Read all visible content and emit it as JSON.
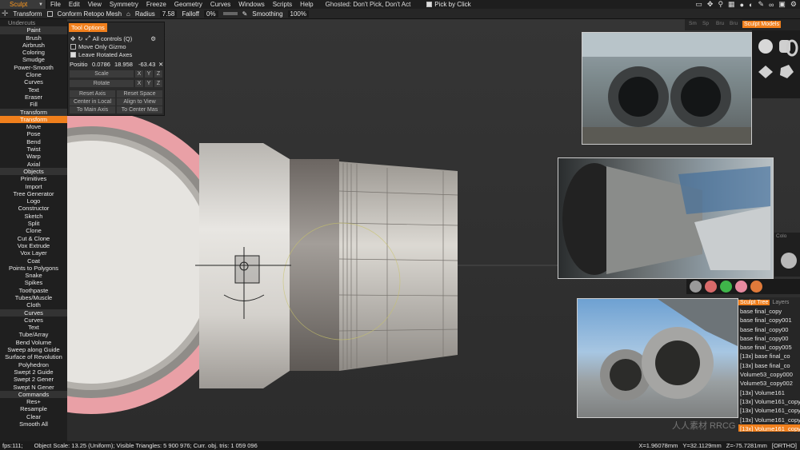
{
  "menubar": {
    "mode": "Sculpt",
    "items": [
      "File",
      "Edit",
      "View",
      "Symmetry",
      "Freeze",
      "Geometry",
      "Curves",
      "Windows",
      "Scripts",
      "Help"
    ],
    "ghosted": "Ghosted: Don't Pick, Don't Act",
    "pick_by_click": "Pick by Click"
  },
  "toolbar": {
    "tool": "Transform",
    "conform": "Conform Retopo Mesh",
    "radius_label": "Radius",
    "radius_value": "7.58",
    "falloff_label": "Falloff",
    "falloff_value": "0%",
    "smoothing_label": "Smoothing",
    "smoothing_value": "100%"
  },
  "left_panel": {
    "top_cut": "Undercuts",
    "paint_header": "Paint",
    "paint": [
      "Brush",
      "Airbrush",
      "Coloring",
      "Smudge",
      "Power-Smooth",
      "Clone",
      "Curves",
      "Text",
      "Eraser",
      "Fill"
    ],
    "transform_header": "Transform",
    "transform": [
      "Transform",
      "Move",
      "Pose",
      "Bend",
      "Twist",
      "Warp",
      "Axial"
    ],
    "objects_header": "Objects",
    "objects": [
      "Primitives",
      "Import",
      "Tree Generator",
      "Logo",
      "Constructor",
      "Sketch",
      "Split",
      "Clone",
      "Cut & Clone",
      "Vox Extrude",
      "Vox Layer",
      "Coat",
      "Points to Polygons",
      "Snake",
      "Spikes",
      "Toothpaste",
      "Tubes/Muscle",
      "Cloth"
    ],
    "curves_header": "Curves",
    "curves": [
      "Curves",
      "Text",
      "Tube/Array",
      "Bend Volume",
      "Sweep along Guide",
      "Surface of Revolution",
      "Polyhedron",
      "Swept 2 Guide",
      "Swept 2 Gener",
      "Swept N Gener"
    ],
    "commands_header": "Commands",
    "commands": [
      "Res+",
      "Resample",
      "Clear",
      "Smooth All"
    ]
  },
  "tool_options": {
    "tab": "Tool Options",
    "all_controls": "All controls (Q)",
    "move_only_gizmo": "Move Only Gizmo",
    "leave_rotated_axes": "Leave Rotated Axes",
    "position_label": "Positio",
    "pos_x": "0.0786",
    "pos_y": "18.958",
    "pos_z": "-63.43",
    "scale": "Scale",
    "rotate": "Rotate",
    "x": "X",
    "y": "Y",
    "z": "Z",
    "reset_axis": "Reset Axis",
    "reset_space": "Reset Space",
    "center_in_local": "Center in Local",
    "align_to_view": "Align to View",
    "to_main_axis": "To Main Axis",
    "to_center_mass": "To Center Mas"
  },
  "right_panels": {
    "strip_tabs": [
      "Sm",
      "Sp",
      "Bru",
      "Bru"
    ],
    "sculpt_models": "Sculpt Models",
    "materials_label": "Colo",
    "swatch_colors": [
      "#9a9a9a",
      "#d96a6a",
      "#3fb54a",
      "#e78aa0",
      "#e07a3a"
    ]
  },
  "sculpt_tree": {
    "tab_active": "Sculpt Tree",
    "tab_layers": "Layers",
    "items": [
      "base final_copy",
      "base final_copy001",
      "base final_copy00",
      "base final_copy00",
      "base final_copy005",
      "[13x] base final_co",
      "[13x] base final_co",
      "Volume53_copy000",
      "Volume53_copy002",
      "[13x] Volume161",
      "[13x] Volume161_copy",
      "[13x] Volume161_copy0",
      "[13x] Volume161_copy",
      "[13x] Volume161_copy"
    ]
  },
  "status": {
    "fps": "fps:111;",
    "info": "Object Scale: 13.25 (Uniform); Visible Triangles: 5 900 976; Curr. obj. tris: 1 059 096",
    "x": "X=1.96078mm",
    "y": "Y=32.1129mm",
    "z": "Z=-75.7281mm",
    "ortho": "[ORTHO]"
  },
  "watermark": "人人素材 RRCG"
}
